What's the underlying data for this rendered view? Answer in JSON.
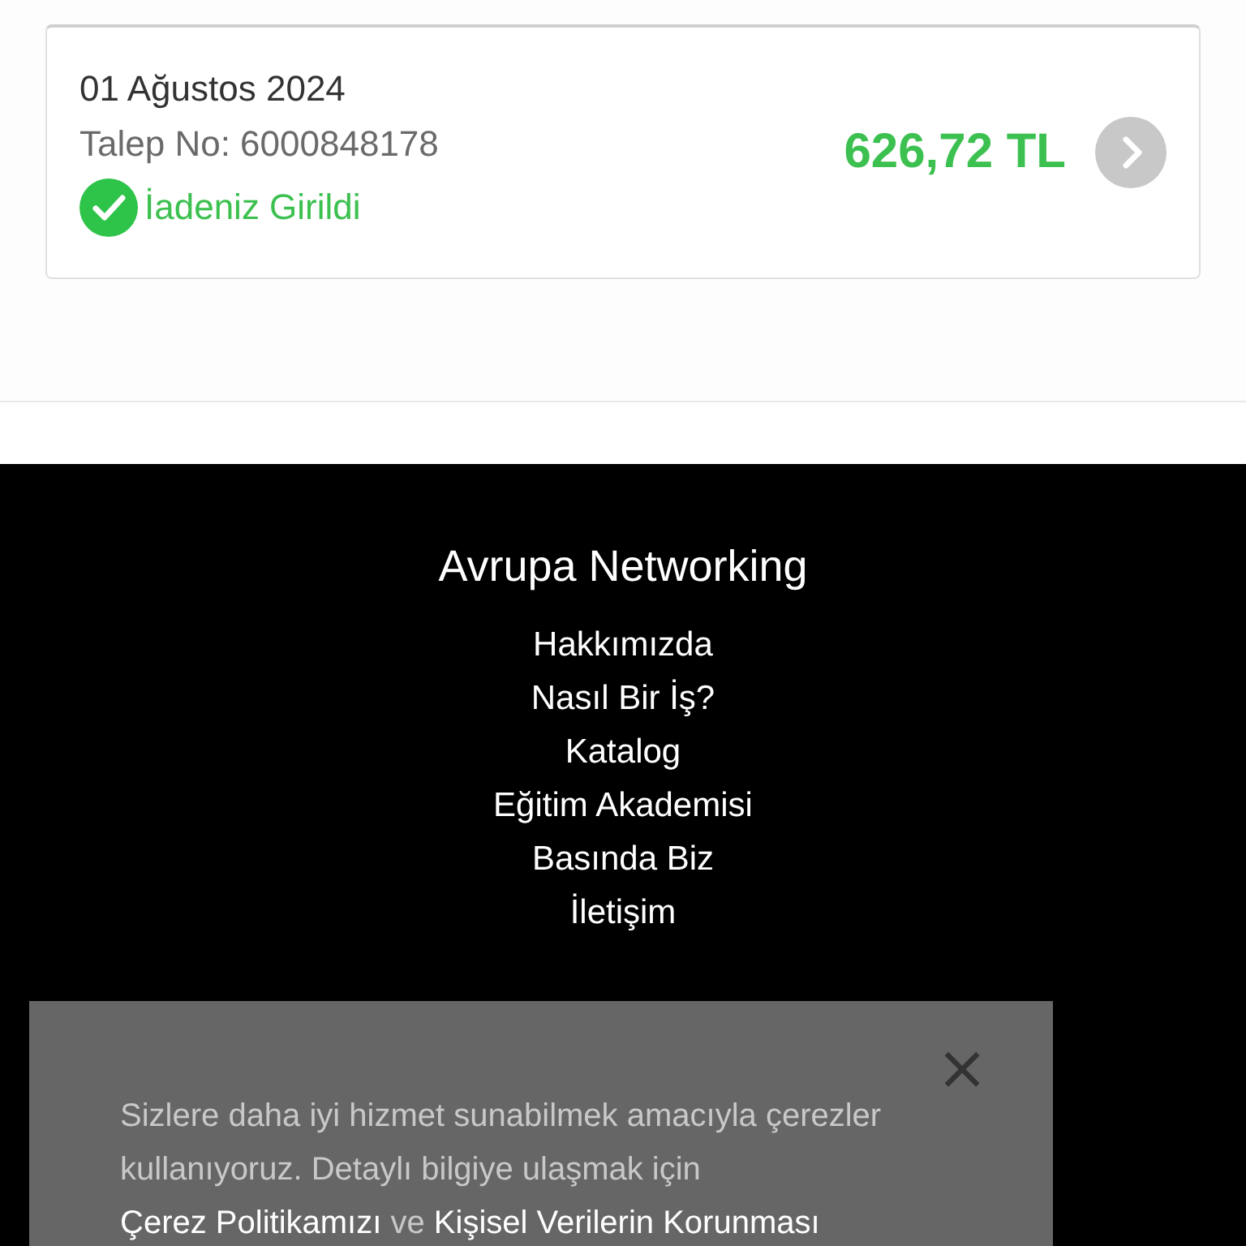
{
  "refund": {
    "date": "01 Ağustos 2024",
    "request_no": "Talep No: 6000848178",
    "status": "İadeniz Girildi",
    "amount": "626,72 TL"
  },
  "footer": {
    "title": "Avrupa Networking",
    "links": [
      "Hakkımızda",
      "Nasıl Bir İş?",
      "Katalog",
      "Eğitim Akademisi",
      "Basında Biz",
      "İletişim"
    ]
  },
  "cookie_notice": {
    "close": "×",
    "text": "Sizlere daha iyi hizmet sunabilmek amacıyla çerezler kullanıyoruz. Detaylı bilgiye ulaşmak için",
    "link_1": "Çerez Politikamızı",
    "connector": "ve",
    "link_2": "Kişisel Verilerin Korunması"
  }
}
